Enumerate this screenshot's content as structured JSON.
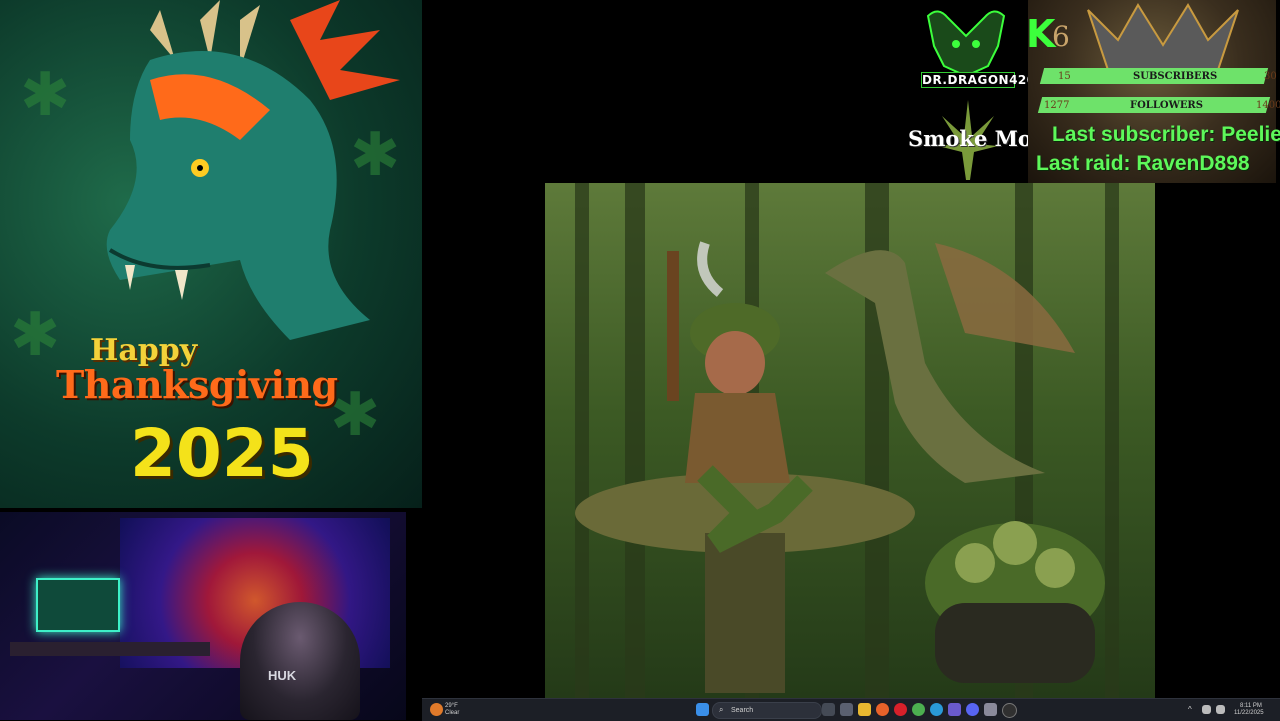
{
  "thanksgiving": {
    "happy": "Happy",
    "thanksgiving": "Thanksgiving",
    "year": "2025"
  },
  "webcam": {
    "shirt_text": "HUK"
  },
  "logo": {
    "name": "DR.DRAGON420",
    "slogan": "Smoke More"
  },
  "stats": {
    "k_label": "K",
    "k_count": "6",
    "subscribers": {
      "current": "15",
      "label": "SUBSCRIBERS",
      "goal": "30"
    },
    "followers": {
      "current": "1277",
      "label": "FOLLOWERS",
      "goal": "1400"
    },
    "last_subscriber": "Last subscriber: Peelies",
    "last_raid": "Last raid: RavenD898"
  },
  "taskbar": {
    "weather_temp": "29°F",
    "weather_cond": "Clear",
    "search_placeholder": "Search",
    "time": "8:11 PM",
    "date": "11/22/2025",
    "pinned_apps": [
      "widgets-icon",
      "task-view-icon",
      "file-explorer-icon",
      "firefox-icon",
      "opera-icon",
      "chrome-icon",
      "edge-icon",
      "teams-icon",
      "discord-icon",
      "settings-icon",
      "obs-icon",
      "streamlabs-icon"
    ]
  },
  "colors": {
    "overlay_green": "#5ef85a",
    "bar_green": "#6ee26a",
    "taskbar_bg": "#1c1f26"
  }
}
